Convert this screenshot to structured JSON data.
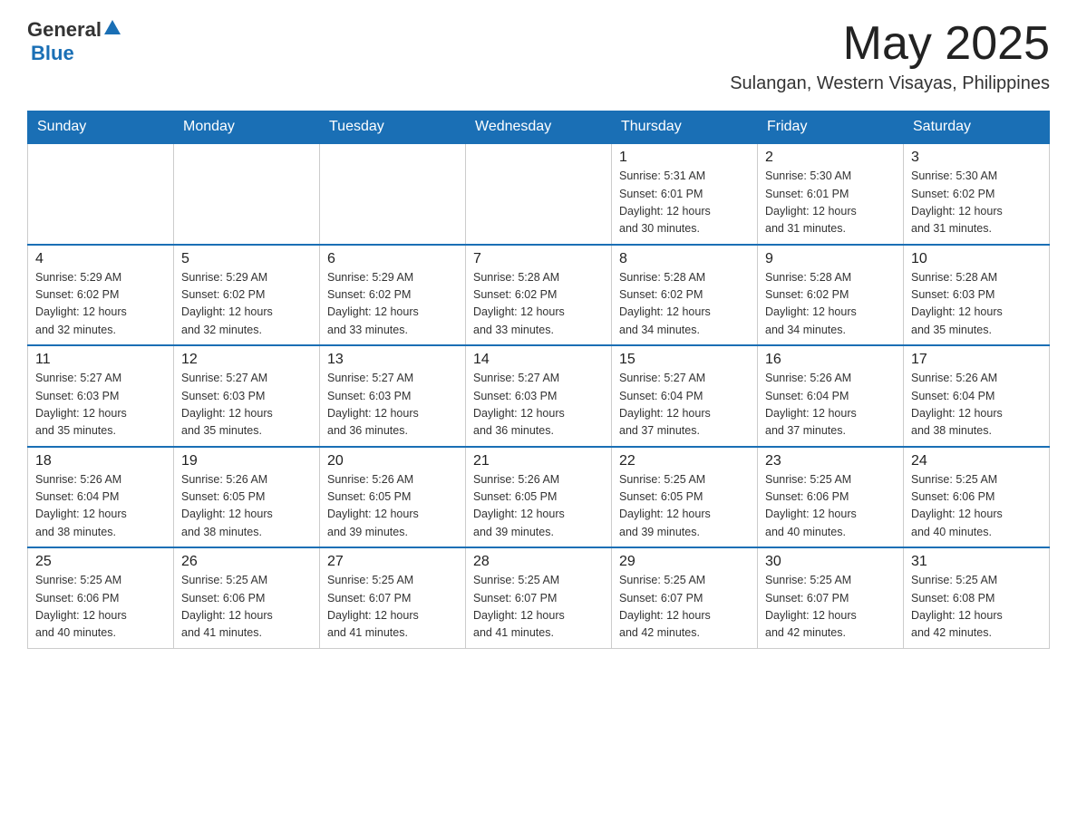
{
  "header": {
    "logo_general": "General",
    "logo_blue": "Blue",
    "month_title": "May 2025",
    "location": "Sulangan, Western Visayas, Philippines"
  },
  "days_of_week": [
    "Sunday",
    "Monday",
    "Tuesday",
    "Wednesday",
    "Thursday",
    "Friday",
    "Saturday"
  ],
  "weeks": [
    [
      {
        "day": "",
        "info": ""
      },
      {
        "day": "",
        "info": ""
      },
      {
        "day": "",
        "info": ""
      },
      {
        "day": "",
        "info": ""
      },
      {
        "day": "1",
        "info": "Sunrise: 5:31 AM\nSunset: 6:01 PM\nDaylight: 12 hours\nand 30 minutes."
      },
      {
        "day": "2",
        "info": "Sunrise: 5:30 AM\nSunset: 6:01 PM\nDaylight: 12 hours\nand 31 minutes."
      },
      {
        "day": "3",
        "info": "Sunrise: 5:30 AM\nSunset: 6:02 PM\nDaylight: 12 hours\nand 31 minutes."
      }
    ],
    [
      {
        "day": "4",
        "info": "Sunrise: 5:29 AM\nSunset: 6:02 PM\nDaylight: 12 hours\nand 32 minutes."
      },
      {
        "day": "5",
        "info": "Sunrise: 5:29 AM\nSunset: 6:02 PM\nDaylight: 12 hours\nand 32 minutes."
      },
      {
        "day": "6",
        "info": "Sunrise: 5:29 AM\nSunset: 6:02 PM\nDaylight: 12 hours\nand 33 minutes."
      },
      {
        "day": "7",
        "info": "Sunrise: 5:28 AM\nSunset: 6:02 PM\nDaylight: 12 hours\nand 33 minutes."
      },
      {
        "day": "8",
        "info": "Sunrise: 5:28 AM\nSunset: 6:02 PM\nDaylight: 12 hours\nand 34 minutes."
      },
      {
        "day": "9",
        "info": "Sunrise: 5:28 AM\nSunset: 6:02 PM\nDaylight: 12 hours\nand 34 minutes."
      },
      {
        "day": "10",
        "info": "Sunrise: 5:28 AM\nSunset: 6:03 PM\nDaylight: 12 hours\nand 35 minutes."
      }
    ],
    [
      {
        "day": "11",
        "info": "Sunrise: 5:27 AM\nSunset: 6:03 PM\nDaylight: 12 hours\nand 35 minutes."
      },
      {
        "day": "12",
        "info": "Sunrise: 5:27 AM\nSunset: 6:03 PM\nDaylight: 12 hours\nand 35 minutes."
      },
      {
        "day": "13",
        "info": "Sunrise: 5:27 AM\nSunset: 6:03 PM\nDaylight: 12 hours\nand 36 minutes."
      },
      {
        "day": "14",
        "info": "Sunrise: 5:27 AM\nSunset: 6:03 PM\nDaylight: 12 hours\nand 36 minutes."
      },
      {
        "day": "15",
        "info": "Sunrise: 5:27 AM\nSunset: 6:04 PM\nDaylight: 12 hours\nand 37 minutes."
      },
      {
        "day": "16",
        "info": "Sunrise: 5:26 AM\nSunset: 6:04 PM\nDaylight: 12 hours\nand 37 minutes."
      },
      {
        "day": "17",
        "info": "Sunrise: 5:26 AM\nSunset: 6:04 PM\nDaylight: 12 hours\nand 38 minutes."
      }
    ],
    [
      {
        "day": "18",
        "info": "Sunrise: 5:26 AM\nSunset: 6:04 PM\nDaylight: 12 hours\nand 38 minutes."
      },
      {
        "day": "19",
        "info": "Sunrise: 5:26 AM\nSunset: 6:05 PM\nDaylight: 12 hours\nand 38 minutes."
      },
      {
        "day": "20",
        "info": "Sunrise: 5:26 AM\nSunset: 6:05 PM\nDaylight: 12 hours\nand 39 minutes."
      },
      {
        "day": "21",
        "info": "Sunrise: 5:26 AM\nSunset: 6:05 PM\nDaylight: 12 hours\nand 39 minutes."
      },
      {
        "day": "22",
        "info": "Sunrise: 5:25 AM\nSunset: 6:05 PM\nDaylight: 12 hours\nand 39 minutes."
      },
      {
        "day": "23",
        "info": "Sunrise: 5:25 AM\nSunset: 6:06 PM\nDaylight: 12 hours\nand 40 minutes."
      },
      {
        "day": "24",
        "info": "Sunrise: 5:25 AM\nSunset: 6:06 PM\nDaylight: 12 hours\nand 40 minutes."
      }
    ],
    [
      {
        "day": "25",
        "info": "Sunrise: 5:25 AM\nSunset: 6:06 PM\nDaylight: 12 hours\nand 40 minutes."
      },
      {
        "day": "26",
        "info": "Sunrise: 5:25 AM\nSunset: 6:06 PM\nDaylight: 12 hours\nand 41 minutes."
      },
      {
        "day": "27",
        "info": "Sunrise: 5:25 AM\nSunset: 6:07 PM\nDaylight: 12 hours\nand 41 minutes."
      },
      {
        "day": "28",
        "info": "Sunrise: 5:25 AM\nSunset: 6:07 PM\nDaylight: 12 hours\nand 41 minutes."
      },
      {
        "day": "29",
        "info": "Sunrise: 5:25 AM\nSunset: 6:07 PM\nDaylight: 12 hours\nand 42 minutes."
      },
      {
        "day": "30",
        "info": "Sunrise: 5:25 AM\nSunset: 6:07 PM\nDaylight: 12 hours\nand 42 minutes."
      },
      {
        "day": "31",
        "info": "Sunrise: 5:25 AM\nSunset: 6:08 PM\nDaylight: 12 hours\nand 42 minutes."
      }
    ]
  ]
}
